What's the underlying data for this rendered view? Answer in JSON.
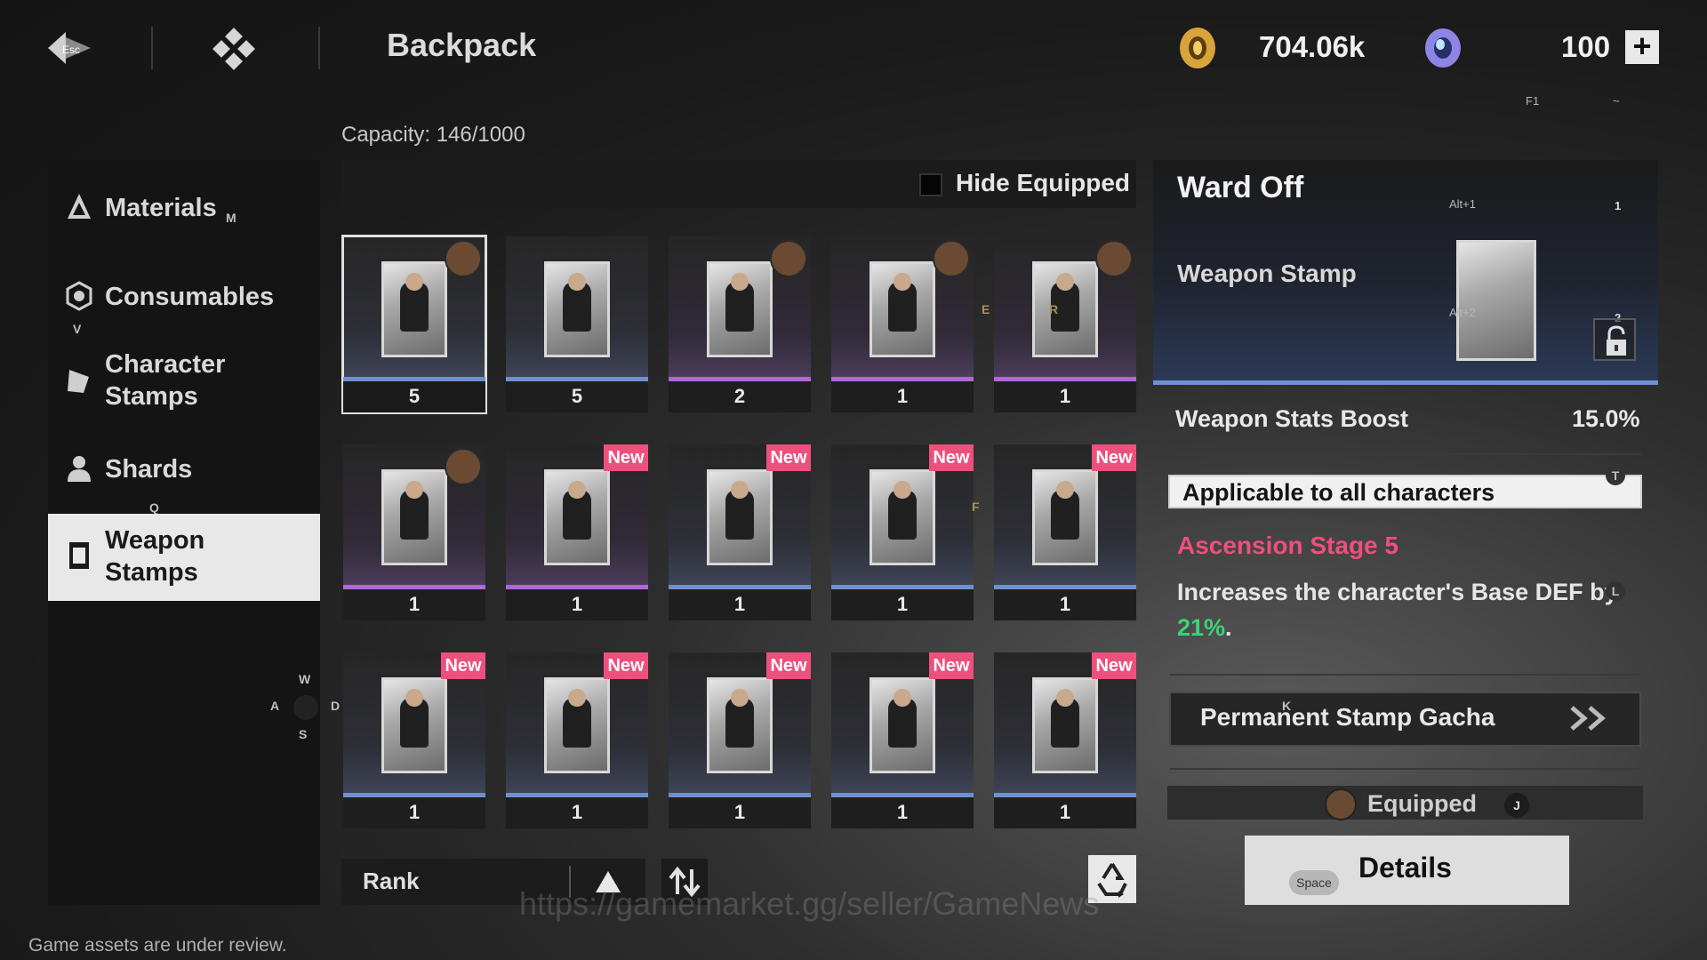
{
  "header": {
    "back_key": "Esc",
    "title": "Backpack",
    "currency_gold": "704.06k",
    "currency_gem": "100",
    "plus": "+",
    "hint_f1": "F1",
    "hint_tilde": "~"
  },
  "capacity": "Capacity: 146/1000",
  "sidebar": {
    "items": [
      {
        "label": "Materials",
        "key": "M",
        "icon": "materials-icon"
      },
      {
        "label": "Consumables",
        "key": "V",
        "icon": "consumables-icon"
      },
      {
        "label": "Character Stamps",
        "key": "",
        "icon": "character-stamps-icon"
      },
      {
        "label": "Shards",
        "key": "Q",
        "icon": "shards-icon"
      },
      {
        "label": "Weapon Stamps",
        "key": "",
        "icon": "weapon-stamps-icon"
      }
    ],
    "active_index": 4,
    "dpad": {
      "w": "W",
      "a": "A",
      "s": "S",
      "d": "D"
    }
  },
  "grid": {
    "hide_equipped": "Hide Equipped",
    "hide_equipped_checked": false,
    "key_hints": {
      "e": "E",
      "r": "R",
      "f": "F"
    },
    "cards": [
      {
        "qty": "5",
        "rarity": "blue",
        "avatar": true,
        "new": false,
        "selected": true
      },
      {
        "qty": "5",
        "rarity": "blue",
        "avatar": false,
        "new": false,
        "selected": false
      },
      {
        "qty": "2",
        "rarity": "purple",
        "avatar": true,
        "new": false,
        "selected": false
      },
      {
        "qty": "1",
        "rarity": "purple",
        "avatar": true,
        "new": false,
        "selected": false
      },
      {
        "qty": "1",
        "rarity": "purple",
        "avatar": true,
        "new": false,
        "selected": false
      },
      {
        "qty": "1",
        "rarity": "purple",
        "avatar": true,
        "new": false,
        "selected": false
      },
      {
        "qty": "1",
        "rarity": "purple",
        "avatar": false,
        "new": true,
        "selected": false
      },
      {
        "qty": "1",
        "rarity": "blue",
        "avatar": false,
        "new": true,
        "selected": false
      },
      {
        "qty": "1",
        "rarity": "blue",
        "avatar": false,
        "new": true,
        "selected": false
      },
      {
        "qty": "1",
        "rarity": "blue",
        "avatar": false,
        "new": true,
        "selected": false
      },
      {
        "qty": "1",
        "rarity": "blue",
        "avatar": false,
        "new": true,
        "selected": false
      },
      {
        "qty": "1",
        "rarity": "blue",
        "avatar": false,
        "new": true,
        "selected": false
      },
      {
        "qty": "1",
        "rarity": "blue",
        "avatar": false,
        "new": true,
        "selected": false
      },
      {
        "qty": "1",
        "rarity": "blue",
        "avatar": false,
        "new": true,
        "selected": false
      },
      {
        "qty": "1",
        "rarity": "blue",
        "avatar": false,
        "new": true,
        "selected": false
      }
    ],
    "new_label": "New"
  },
  "sort": {
    "label": "Rank"
  },
  "detail": {
    "title": "Ward Off",
    "type": "Weapon Stamp",
    "key_alt1": "Alt+1",
    "key_alt2": "Alt+2",
    "num1": "1",
    "num2": "2",
    "stat_label": "Weapon Stats Boost",
    "stat_value": "15.0%",
    "applicable": "Applicable to all characters",
    "key_t": "T",
    "ascension_title": "Ascension Stage 5",
    "ascension_text": "Increases the character's Base DEF by",
    "ascension_value": "21%",
    "ascension_end": ".",
    "key_l": "L",
    "gacha": "Permanent Stamp Gacha",
    "key_k": "K",
    "equipped": "Equipped",
    "key_j": "J",
    "details": "Details",
    "key_space": "Space"
  },
  "footer": {
    "note": "Game assets are under review.",
    "watermark": "https://gamemarket.gg/seller/GameNews"
  },
  "colors": {
    "accent_pink": "#ef4f7d",
    "accent_green": "#3fd27a",
    "rarity_blue": "#6f8fcf",
    "rarity_purple": "#b266d8"
  }
}
